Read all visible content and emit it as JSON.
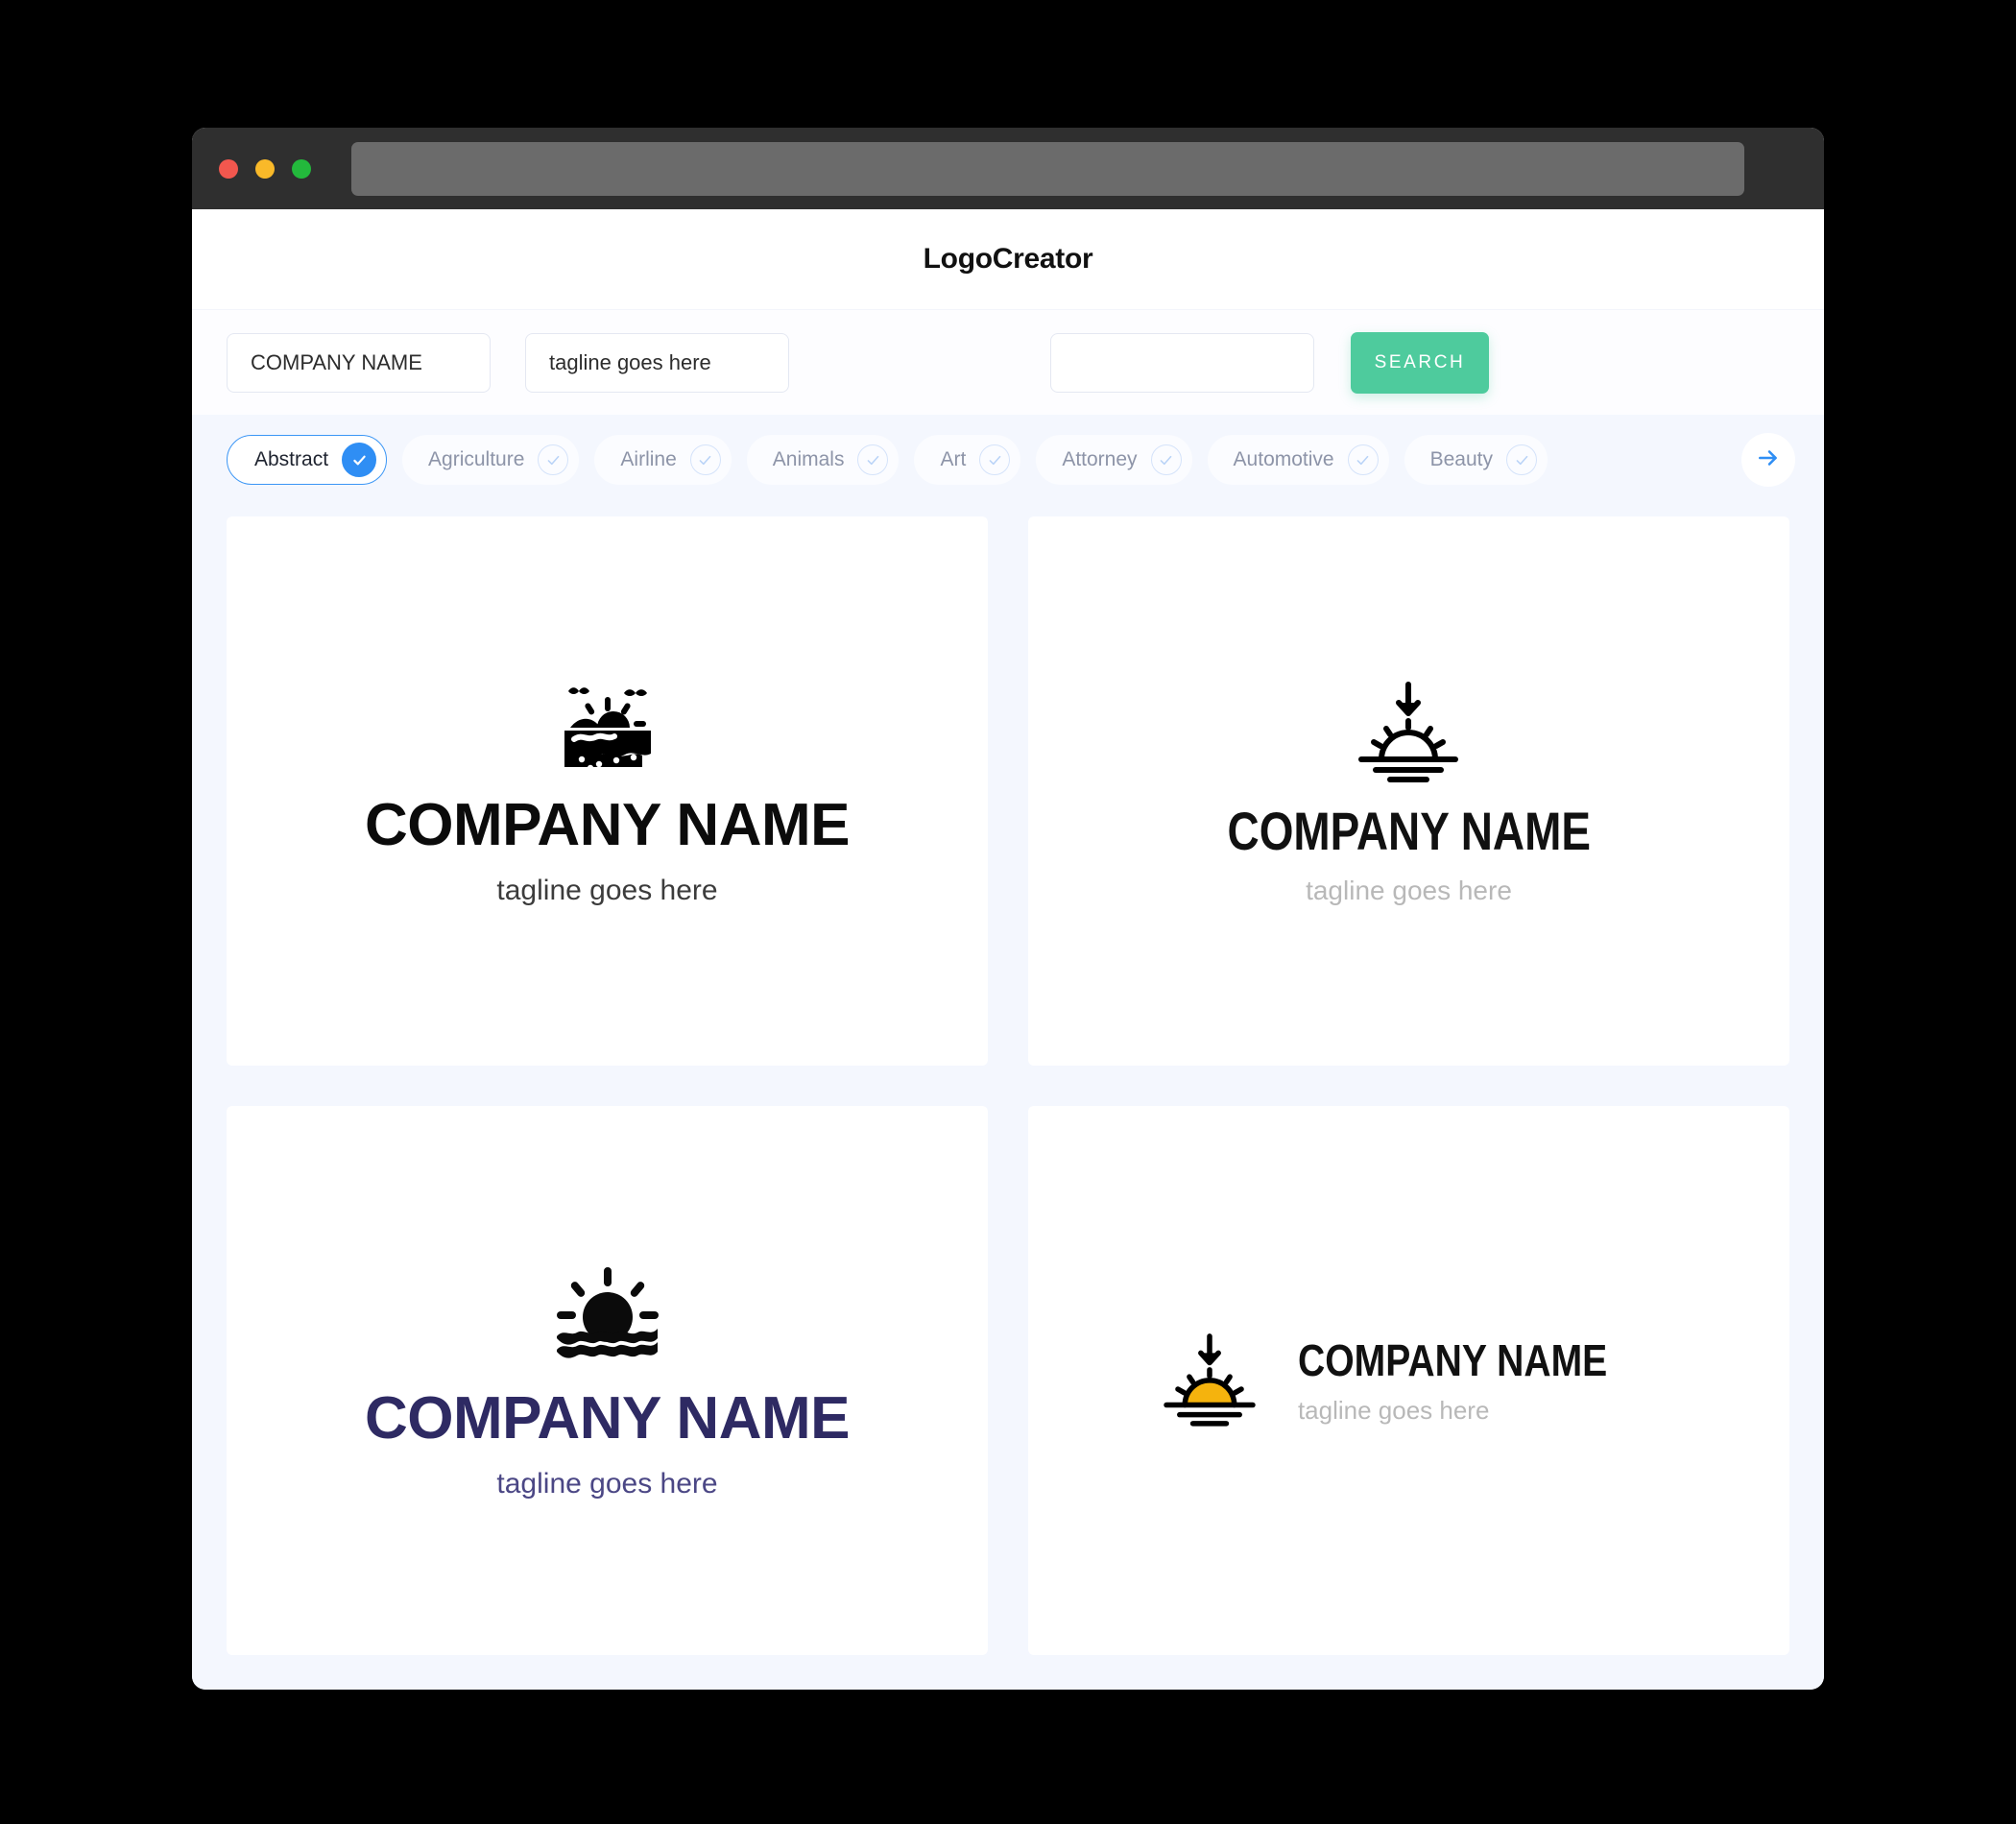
{
  "window": {
    "traffic_lights": [
      {
        "name": "close",
        "color": "#f2574e"
      },
      {
        "name": "minimize",
        "color": "#f9b929"
      },
      {
        "name": "maximize",
        "color": "#23b93c"
      }
    ],
    "url_value": ""
  },
  "header": {
    "title": "LogoCreator"
  },
  "search": {
    "company_value": "COMPANY NAME",
    "tagline_value": "tagline goes here",
    "extra_value": "",
    "button_label": "SEARCH",
    "button_color": "#4ecb9d"
  },
  "categories": {
    "active_color": "#3b96f5",
    "next_icon": "arrow-right-icon",
    "items": [
      {
        "label": "Abstract",
        "selected": true
      },
      {
        "label": "Agriculture",
        "selected": false
      },
      {
        "label": "Airline",
        "selected": false
      },
      {
        "label": "Animals",
        "selected": false
      },
      {
        "label": "Art",
        "selected": false
      },
      {
        "label": "Attorney",
        "selected": false
      },
      {
        "label": "Automotive",
        "selected": false
      },
      {
        "label": "Beauty",
        "selected": false
      }
    ]
  },
  "results": {
    "cards": [
      {
        "icon": "sunrise-hills-water-icon",
        "layout": "vertical",
        "company": "COMPANY NAME",
        "tagline": "tagline goes here",
        "text_color": "#0b0b0b",
        "tagline_color": "#3c3c3c",
        "accent_color": "#000000"
      },
      {
        "icon": "arrow-down-sunset-lines-icon",
        "layout": "vertical",
        "company": "COMPANY NAME",
        "tagline": "tagline goes here",
        "text_color": "#111111",
        "tagline_color": "#b8b8b8",
        "accent_color": "#000000"
      },
      {
        "icon": "sun-waves-icon",
        "layout": "vertical",
        "company": "COMPANY NAME",
        "tagline": "tagline goes here",
        "text_color": "#2e2a63",
        "tagline_color": "#4b4785",
        "accent_color": "#2e2a63"
      },
      {
        "icon": "arrow-down-sunset-lines-orange-icon",
        "layout": "horizontal",
        "company": "COMPANY NAME",
        "tagline": "tagline goes here",
        "text_color": "#111111",
        "tagline_color": "#b8b8b8",
        "accent_color": "#f5b30d"
      }
    ]
  }
}
